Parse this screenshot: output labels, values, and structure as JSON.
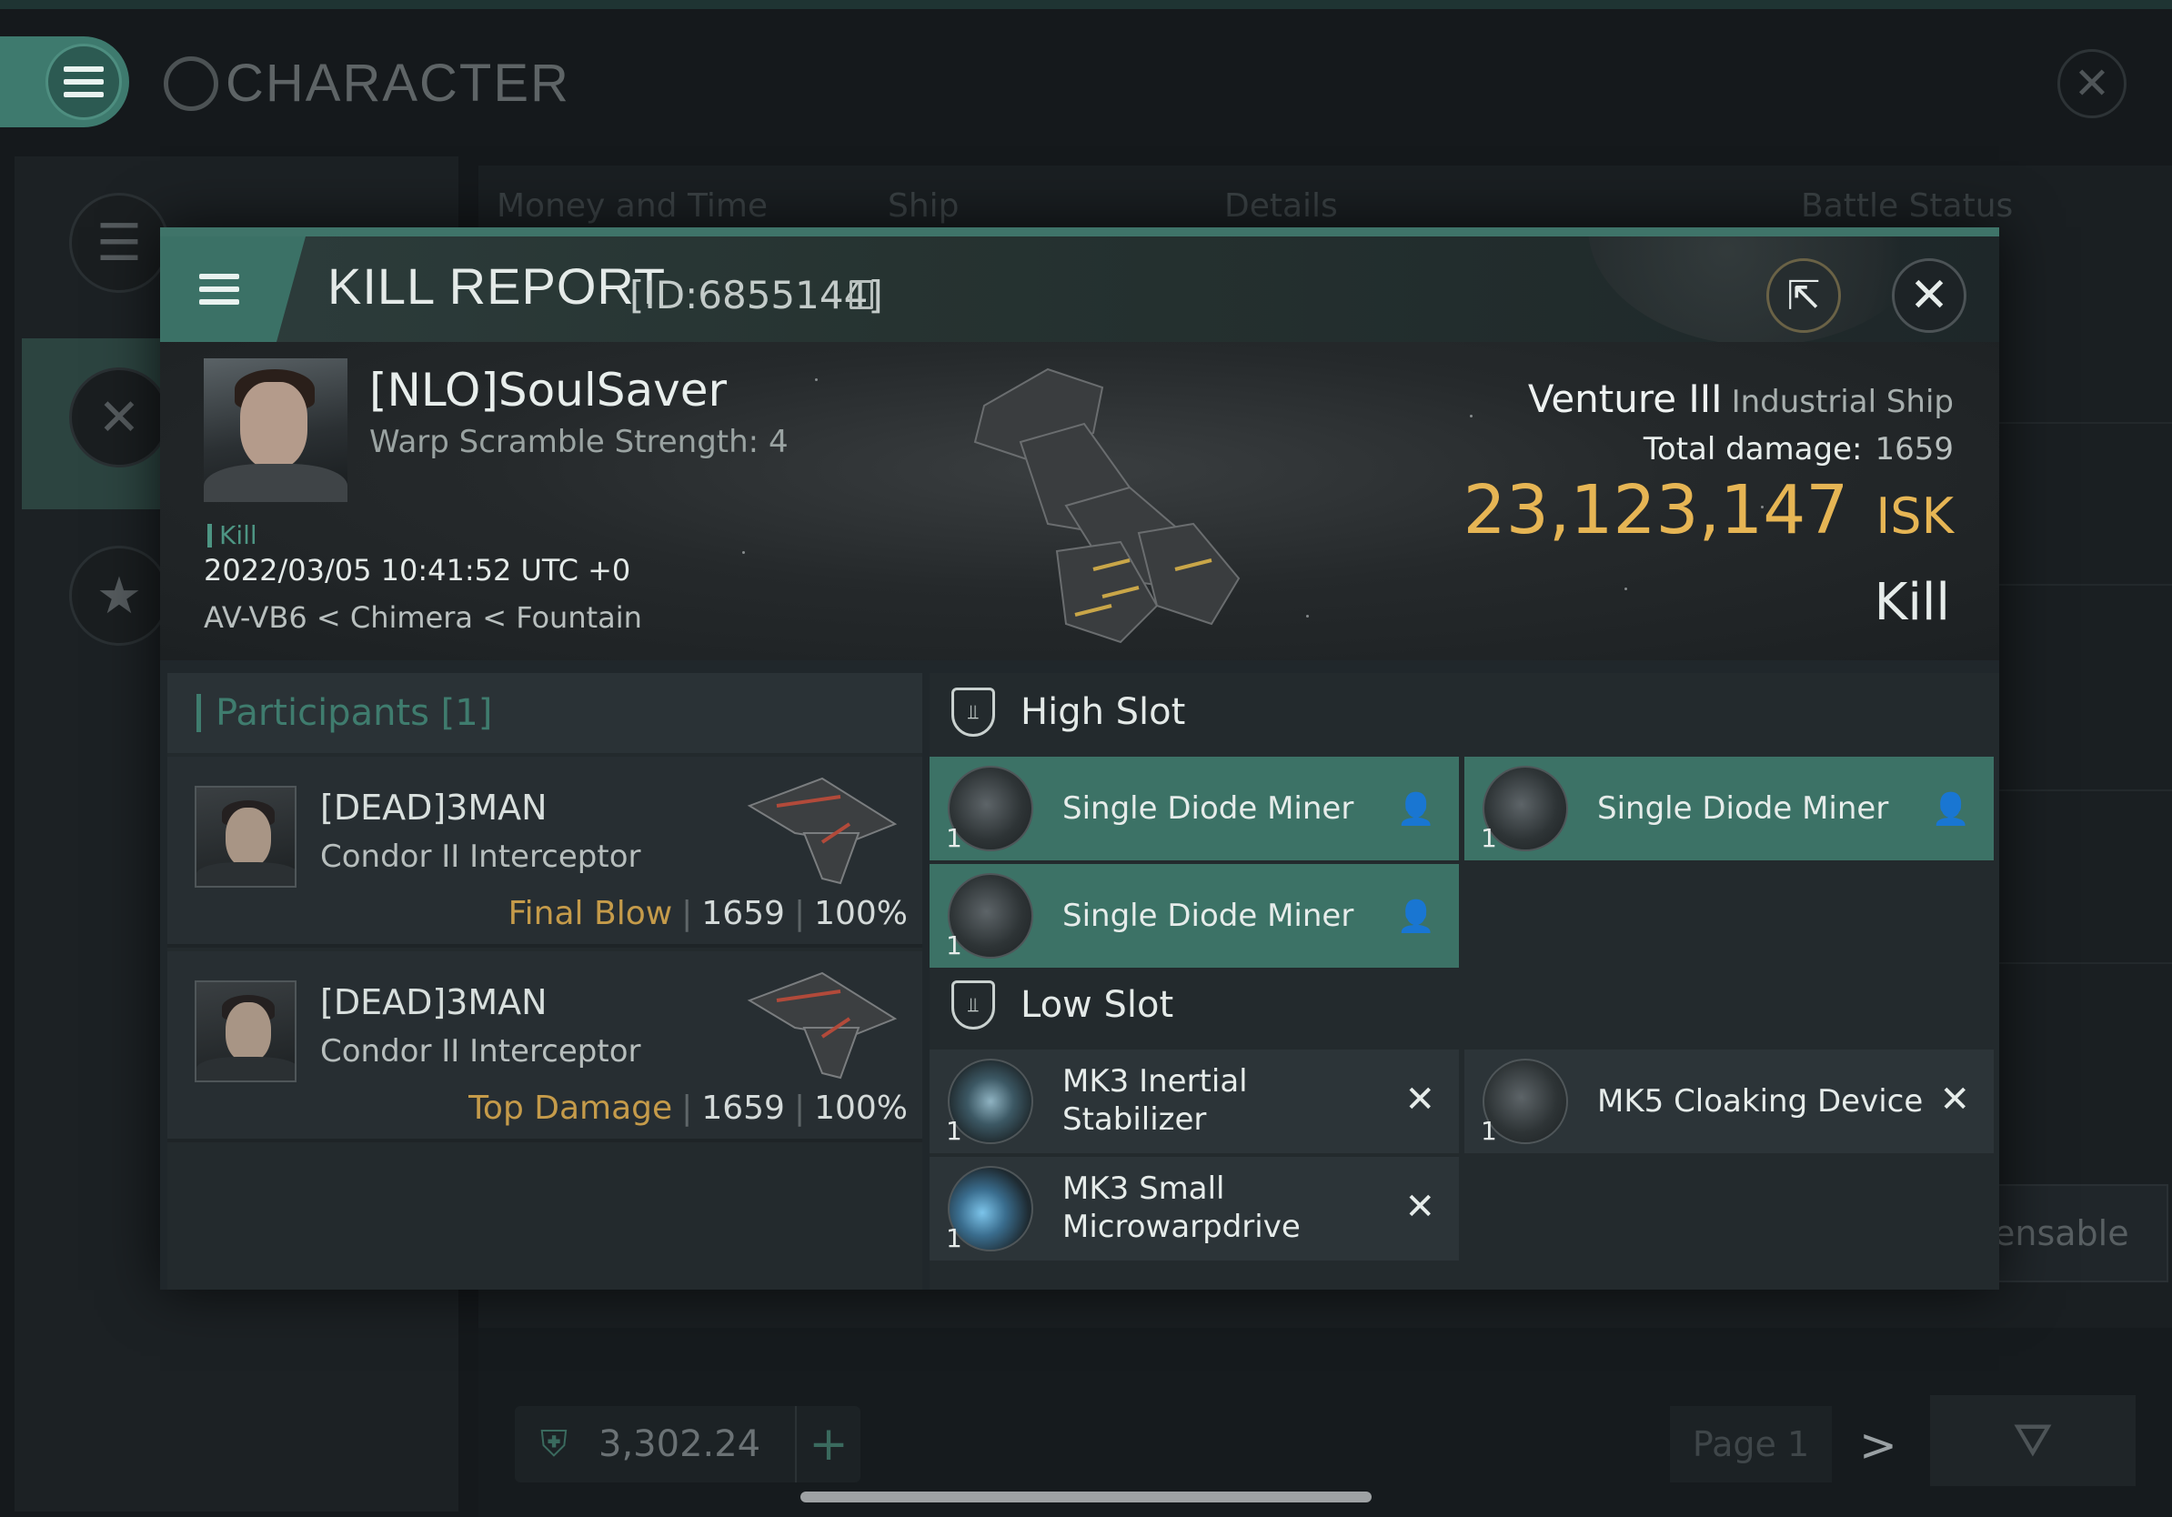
{
  "background": {
    "title": "CHARACTER",
    "tabs": [
      "Money and Time",
      "Ship",
      "Details",
      "Battle Status"
    ],
    "dispensable_partial": "ensable",
    "wallet_value": "3,302.24",
    "page_label": "Page 1"
  },
  "modal": {
    "title": "KILL REPORT",
    "id_label": "[ID:6855144]",
    "victim": {
      "name": "[NLO]SoulSaver",
      "warp_scramble": "Warp Scramble Strength: 4",
      "tag": "Kill",
      "datetime": "2022/03/05 10:41:52 UTC +0",
      "location": "AV-VB6 < Chimera < Fountain",
      "ship_name": "Venture III",
      "ship_class": "Industrial Ship",
      "total_damage_label": "Total damage:",
      "total_damage_value": "1659",
      "isk_value": "23,123,147",
      "isk_unit": "ISK",
      "result": "Kill"
    },
    "participants": {
      "header": "Participants [1]",
      "rows": [
        {
          "name": "[DEAD]3MAN",
          "ship": "Condor II Interceptor",
          "role": "Final Blow",
          "damage": "1659",
          "percent": "100%"
        },
        {
          "name": "[DEAD]3MAN",
          "ship": "Condor II Interceptor",
          "role": "Top Damage",
          "damage": "1659",
          "percent": "100%"
        }
      ]
    },
    "high_slot": {
      "label": "High Slot",
      "items": [
        {
          "name": "Single Diode Miner",
          "qty": "1",
          "status": "fitted"
        },
        {
          "name": "Single Diode Miner",
          "qty": "1",
          "status": "fitted"
        },
        {
          "name": "Single Diode Miner",
          "qty": "1",
          "status": "fitted"
        }
      ]
    },
    "low_slot": {
      "label": "Low Slot",
      "items": [
        {
          "name": "MK3 Inertial Stabilizer",
          "qty": "1",
          "status": "destroyed"
        },
        {
          "name": "MK5 Cloaking Device",
          "qty": "1",
          "status": "destroyed"
        },
        {
          "name": "MK3 Small Microwarpdrive",
          "qty": "1",
          "status": "destroyed"
        }
      ]
    }
  }
}
